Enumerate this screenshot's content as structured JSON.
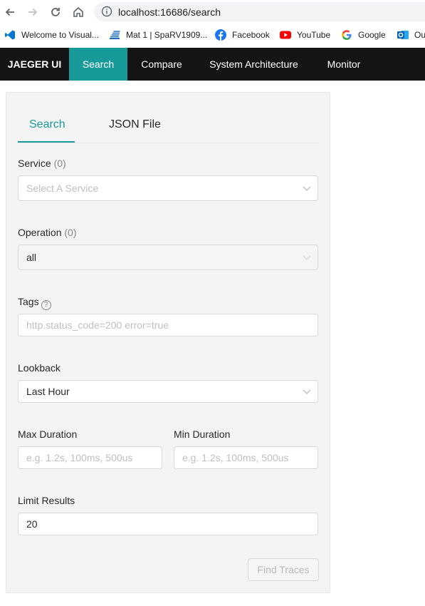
{
  "browser": {
    "url": "localhost:16686/search",
    "bookmarks": [
      {
        "label": "Welcome to Visual...",
        "icon": "vscode-icon"
      },
      {
        "label": "Mat 1 | SpaRV1909...",
        "icon": "stack-icon"
      },
      {
        "label": "Facebook",
        "icon": "facebook-icon"
      },
      {
        "label": "YouTube",
        "icon": "youtube-icon"
      },
      {
        "label": "Google",
        "icon": "google-icon"
      },
      {
        "label": "Ou",
        "icon": "outlook-icon"
      }
    ]
  },
  "nav": {
    "brand": "JAEGER UI",
    "items": [
      {
        "label": "Search",
        "active": true
      },
      {
        "label": "Compare",
        "active": false
      },
      {
        "label": "System Architecture",
        "active": false
      },
      {
        "label": "Monitor",
        "active": false
      }
    ]
  },
  "search": {
    "tabs": [
      {
        "label": "Search",
        "active": true
      },
      {
        "label": "JSON File",
        "active": false
      }
    ],
    "service": {
      "label": "Service",
      "count": "(0)",
      "placeholder": "Select A Service"
    },
    "operation": {
      "label": "Operation",
      "count": "(0)",
      "value": "all"
    },
    "tags": {
      "label": "Tags",
      "help": "?",
      "placeholder": "http.status_code=200 error=true"
    },
    "lookback": {
      "label": "Lookback",
      "value": "Last Hour"
    },
    "max_duration": {
      "label": "Max Duration",
      "placeholder": "e.g. 1.2s, 100ms, 500us"
    },
    "min_duration": {
      "label": "Min Duration",
      "placeholder": "e.g. 1.2s, 100ms, 500us"
    },
    "limit": {
      "label": "Limit Results",
      "value": "20"
    },
    "find_button": "Find Traces"
  },
  "colors": {
    "accent": "#199a9a",
    "topbar": "#141414",
    "panel": "#f4f4f4"
  }
}
